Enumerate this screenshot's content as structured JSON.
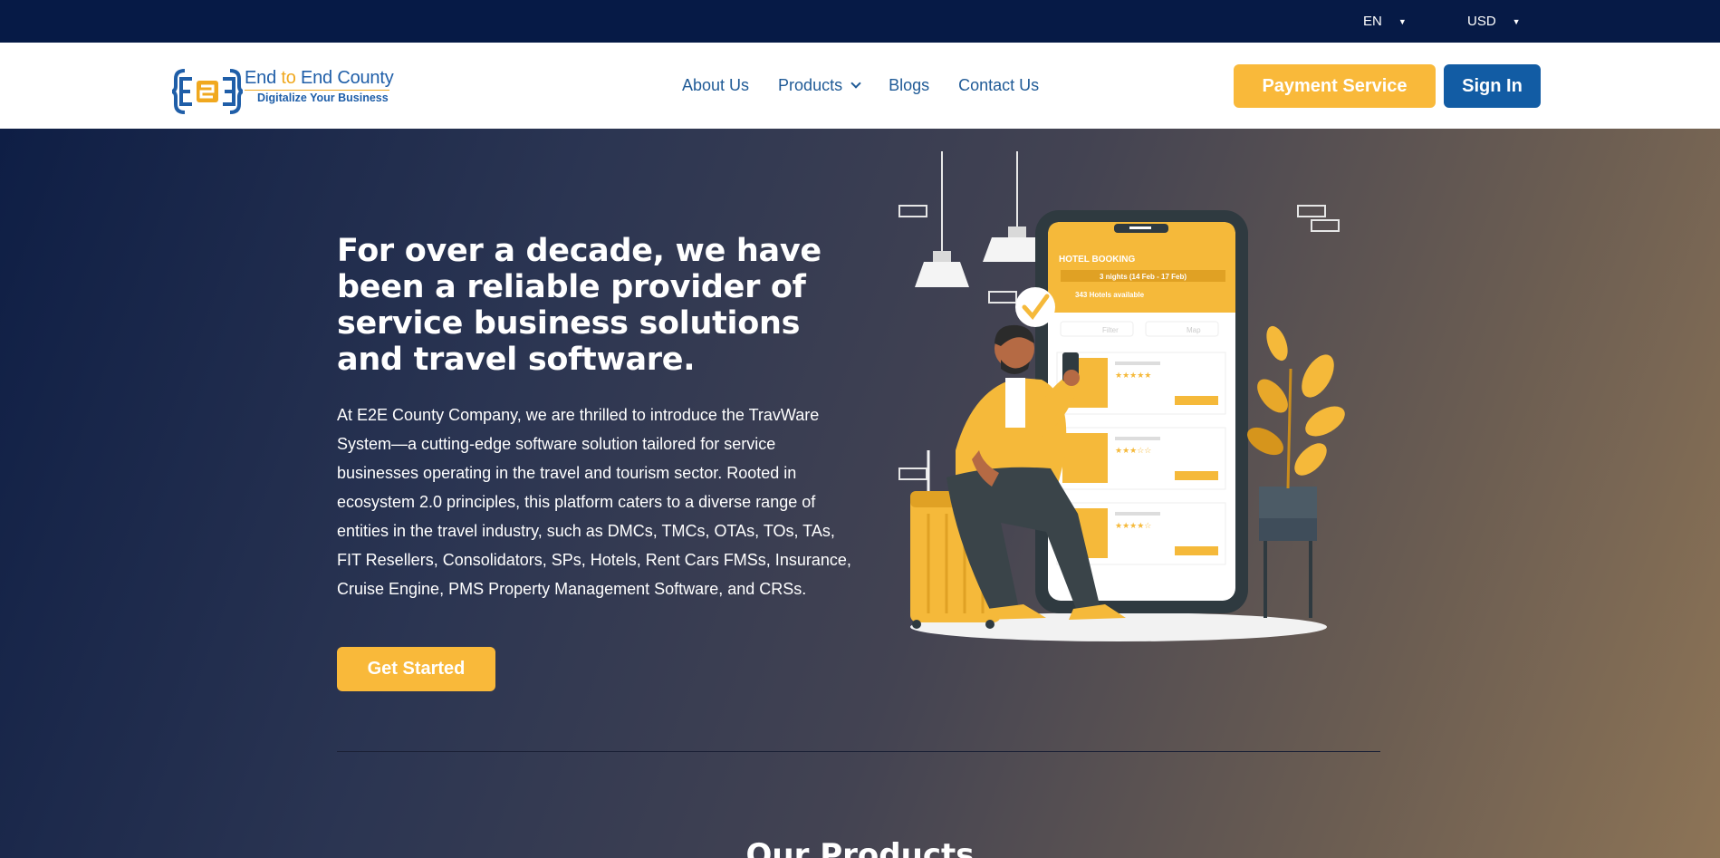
{
  "topbar": {
    "language": "EN",
    "currency": "USD"
  },
  "brand": {
    "name_part1": "End ",
    "name_part2": "to",
    "name_part3": " End County",
    "tagline": "Digitalize Your Business",
    "colors": {
      "blue": "#1f5ea8",
      "gold": "#f0a81f"
    }
  },
  "nav": {
    "items": [
      {
        "label": "About Us"
      },
      {
        "label": "Products"
      },
      {
        "label": "Blogs"
      },
      {
        "label": "Contact Us"
      }
    ],
    "payment_label": "Payment Service",
    "signin_label": "Sign In"
  },
  "hero": {
    "title": "For over a decade, we have been a reliable provider of service business solutions and travel software.",
    "description": "At E2E County Company, we are thrilled to introduce the TravWare System—a cutting-edge software solution tailored for service businesses operating in the travel and tourism sector. Rooted in ecosystem 2.0 principles, this platform caters to a diverse range of entities in the travel industry, such as DMCs, TMCs, OTAs, TOs, TAs, FIT Resellers, Consolidators, SPs, Hotels, Rent Cars FMSs, Insurance, Cruise Engine, PMS Property Management Software, and CRSs.",
    "cta_label": "Get Started"
  },
  "illustration": {
    "app_title": "HOTEL BOOKING",
    "dates": "3 nights (14 Feb - 17 Feb)",
    "results": "343 Hotels available",
    "filter_label": "Filter",
    "map_label": "Map"
  },
  "section": {
    "title": "Our Products"
  },
  "theme": {
    "accent": "#f9b93a",
    "primary": "#125ca4",
    "topbar": "#061a46"
  }
}
